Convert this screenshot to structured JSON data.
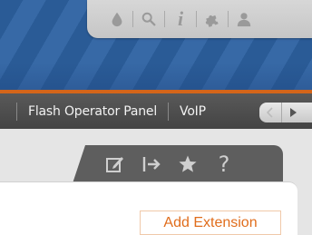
{
  "toolbar": {
    "icons": [
      "drop-icon",
      "search-icon",
      "info-icon",
      "puzzle-icon",
      "user-icon"
    ],
    "info_glyph": "i"
  },
  "nav": {
    "items": [
      {
        "label": "Flash Operator Panel"
      },
      {
        "label": "VoIP"
      }
    ]
  },
  "tab": {
    "icons": [
      "edit-icon",
      "export-icon",
      "star-icon",
      "help-icon"
    ],
    "help_glyph": "?"
  },
  "panel": {
    "add_button_label": "Add Extension"
  },
  "colors": {
    "accent": "#d4651a",
    "button_text": "#e06d1c",
    "nav_bg": "#4e4e4e",
    "banner": "#2f609d"
  }
}
